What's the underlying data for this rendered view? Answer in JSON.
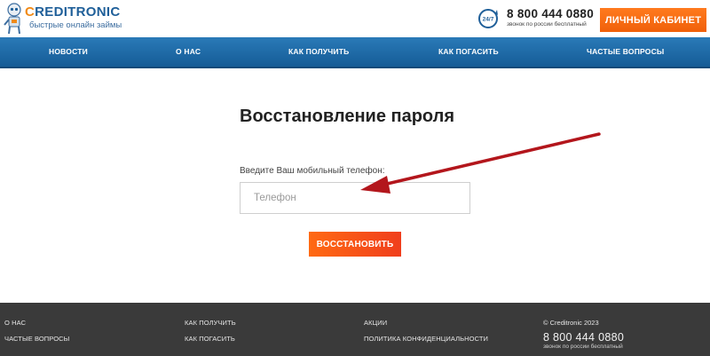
{
  "header": {
    "logo_prefix": "C",
    "logo_rest": "REDITRONIC",
    "logo_tagline": "быстрые онлайн займы",
    "phone_badge": "24/7",
    "phone_number": "8 800 444 0880",
    "phone_note": "звонок по россии бесплатный",
    "cabinet_button": "ЛИЧНЫЙ КАБИНЕТ"
  },
  "nav": {
    "items": [
      "НОВОСТИ",
      "О НАС",
      "КАК ПОЛУЧИТЬ",
      "КАК ПОГАСИТЬ",
      "ЧАСТЫЕ ВОПРОСЫ"
    ]
  },
  "main": {
    "title": "Восстановление пароля",
    "field_label": "Введите Ваш мобильный телефон:",
    "phone_placeholder": "Телефон",
    "restore_button": "ВОССТАНОВИТЬ"
  },
  "footer": {
    "col1": [
      "О НАС",
      "ЧАСТЫЕ ВОПРОСЫ"
    ],
    "col2": [
      "КАК ПОЛУЧИТЬ",
      "КАК ПОГАСИТЬ"
    ],
    "col3": [
      "АКЦИИ",
      "ПОЛИТИКА КОНФИДЕНЦИАЛЬНОСТИ"
    ],
    "copyright": "© Creditronic 2023",
    "phone_number": "8 800 444 0880",
    "phone_note": "звонок по россии бесплатный"
  },
  "colors": {
    "accent": "#f0600a",
    "nav": "#1f6aa8",
    "arrow": "#b3161c",
    "footer": "#3a3a3a"
  }
}
